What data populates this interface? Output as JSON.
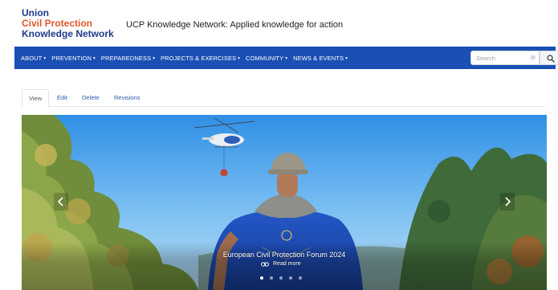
{
  "header": {
    "logo_lines": [
      "Union",
      "Civil Protection",
      "Knowledge Network"
    ],
    "slogan": "UCP Knowledge Network: Applied knowledge for action"
  },
  "nav": {
    "items": [
      {
        "label": "ABOUT"
      },
      {
        "label": "PREVENTION"
      },
      {
        "label": "PREPAREDNESS"
      },
      {
        "label": "PROJECTS & EXERCISES"
      },
      {
        "label": "COMMUNITY"
      },
      {
        "label": "NEWS & EVENTS"
      }
    ],
    "caret": "▾",
    "search_placeholder": "Search",
    "clear_symbol": "⊗"
  },
  "tabs": {
    "view": "View",
    "edit": "Edit",
    "delete": "Delete",
    "revisions": "Revisions"
  },
  "carousel": {
    "title": "European Civil Protection Forum 2024",
    "read_more": "Read more",
    "slide_count": 5,
    "active_index": 0
  },
  "colors": {
    "nav_bg": "#1a4fb4",
    "logo_blue": "#1f3a8a",
    "logo_orange": "#e0562b",
    "link_blue": "#2a5db0"
  }
}
